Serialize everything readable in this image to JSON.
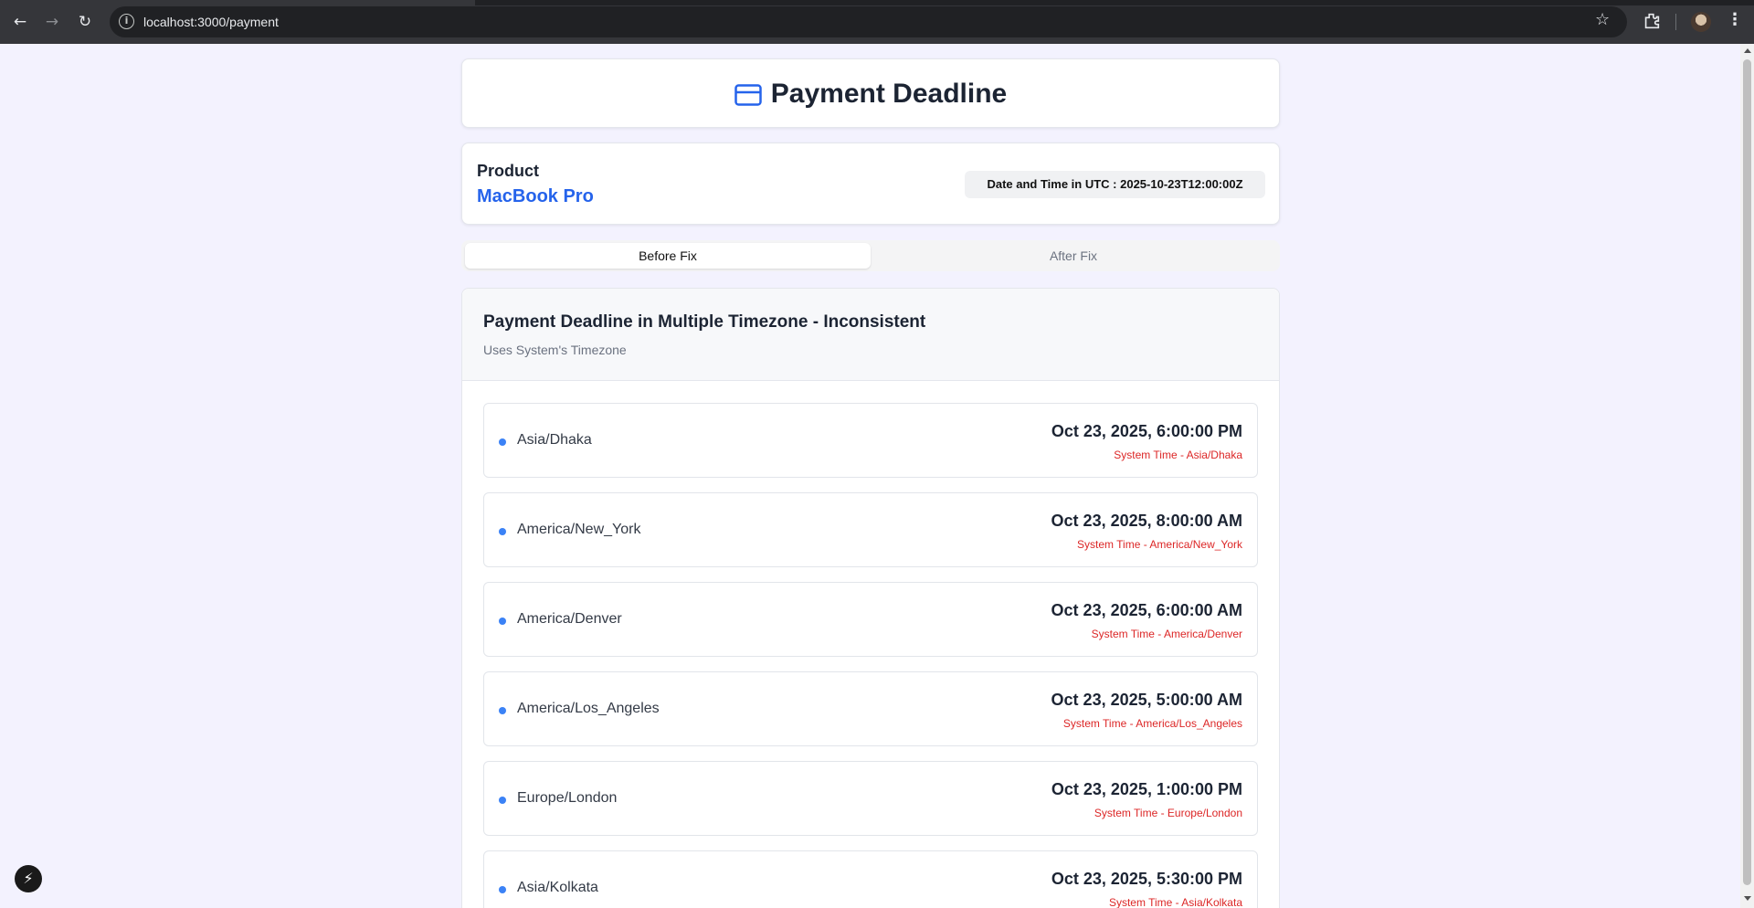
{
  "browser": {
    "url": "localhost:3000/payment",
    "icons": [
      "back-icon",
      "forward-icon",
      "reload-icon",
      "site-info-icon",
      "bookmark-star-icon",
      "extensions-icon",
      "profile-avatar",
      "menu-kebab-icon"
    ]
  },
  "page": {
    "title": "Payment Deadline",
    "title_icon": "credit-card-icon",
    "accent_color": "#2563eb"
  },
  "product": {
    "label": "Product",
    "name": "MacBook Pro",
    "utc_label": "Date and Time in UTC : 2025-10-23T12:00:00Z"
  },
  "tabs": {
    "before": "Before Fix",
    "after": "After Fix",
    "active": "Before Fix"
  },
  "panel": {
    "title": "Payment Deadline in Multiple Timezone - Inconsistent",
    "subtitle": "Uses System's Timezone",
    "rows": [
      {
        "timezone": "Asia/Dhaka",
        "time": "Oct 23, 2025, 6:00:00 PM",
        "system": "System Time - Asia/Dhaka"
      },
      {
        "timezone": "America/New_York",
        "time": "Oct 23, 2025, 8:00:00 AM",
        "system": "System Time - America/New_York"
      },
      {
        "timezone": "America/Denver",
        "time": "Oct 23, 2025, 6:00:00 AM",
        "system": "System Time - America/Denver"
      },
      {
        "timezone": "America/Los_Angeles",
        "time": "Oct 23, 2025, 5:00:00 AM",
        "system": "System Time - America/Los_Angeles"
      },
      {
        "timezone": "Europe/London",
        "time": "Oct 23, 2025, 1:00:00 PM",
        "system": "System Time - Europe/London"
      },
      {
        "timezone": "Asia/Kolkata",
        "time": "Oct 23, 2025, 5:30:00 PM",
        "system": "System Time - Asia/Kolkata"
      }
    ]
  },
  "overlay": {
    "dev_tools_icon": "lightning-bolt-icon"
  }
}
